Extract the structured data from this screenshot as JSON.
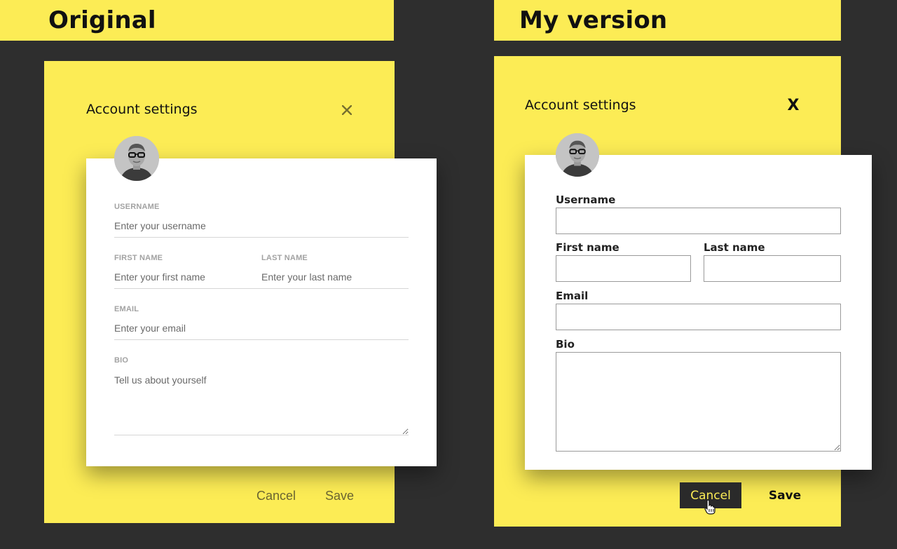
{
  "labels": {
    "original": "Original",
    "mine": "My version"
  },
  "colors": {
    "background": "#2e2e2e",
    "panel": "#fcec55",
    "card": "#ffffff",
    "cancel_button_bg": "#2a2a2a",
    "cancel_button_text": "#fcec55"
  },
  "original": {
    "title": "Account settings",
    "close_icon": "close-icon",
    "fields": {
      "username_label": "USERNAME",
      "username_placeholder": "Enter your username",
      "first_name_label": "FIRST NAME",
      "first_name_placeholder": "Enter your first name",
      "last_name_label": "LAST NAME",
      "last_name_placeholder": "Enter your last name",
      "email_label": "EMAIL",
      "email_placeholder": "Enter your email",
      "bio_label": "BIO",
      "bio_placeholder": "Tell us about yourself"
    },
    "actions": {
      "cancel": "Cancel",
      "save": "Save"
    }
  },
  "mine": {
    "title": "Account settings",
    "close_label": "X",
    "fields": {
      "username_label": "Username",
      "first_name_label": "First name",
      "last_name_label": "Last name",
      "email_label": "Email",
      "bio_label": "Bio"
    },
    "actions": {
      "cancel": "Cancel",
      "save": "Save"
    }
  }
}
